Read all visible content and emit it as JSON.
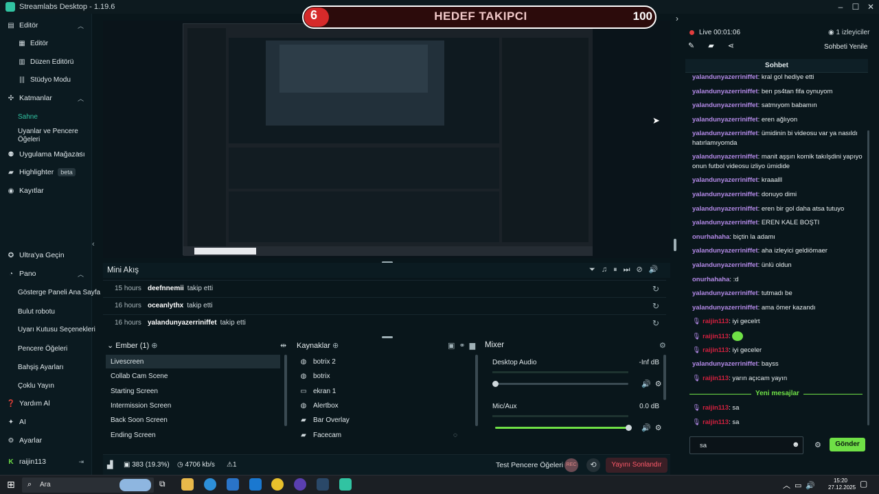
{
  "app": {
    "title": "Streamlabs Desktop - 1.19.6"
  },
  "sidebar": {
    "items": [
      {
        "label": "Editör",
        "icon": "layout-icon",
        "top": 0
      },
      {
        "label": "Editör",
        "icon": "grid-icon"
      },
      {
        "label": "Düzen Editörü",
        "icon": "columns-icon"
      },
      {
        "label": "Stüdyo Modu",
        "icon": "bars-icon"
      },
      {
        "label": "Katmanlar",
        "icon": "layers-icon"
      },
      {
        "label": "Sahne"
      },
      {
        "label": "Uyanlar ve Pencere Öğeleri"
      },
      {
        "label": "Uygulama Mağazası",
        "icon": "store-icon"
      },
      {
        "label": "Highlighter",
        "icon": "highlighter-icon",
        "badge": "beta"
      },
      {
        "label": "Kayıtlar",
        "icon": "record-icon"
      },
      {
        "label": "Ultra'ya Geçin",
        "icon": "ultra-icon"
      },
      {
        "label": "Pano",
        "icon": "dashboard-icon"
      },
      {
        "label": "Gösterge Paneli Ana Sayfa"
      },
      {
        "label": "Bulut robotu"
      },
      {
        "label": "Uyarı Kutusu Seçenekleri"
      },
      {
        "label": "Pencere Öğeleri"
      },
      {
        "label": "Bahşiş Ayarları"
      },
      {
        "label": "Çoklu Yayın"
      },
      {
        "label": "Yardım Al",
        "icon": "help-icon"
      },
      {
        "label": "AI",
        "icon": "ai-icon"
      },
      {
        "label": "Ayarlar",
        "icon": "settings-icon"
      }
    ],
    "user": "raijin113"
  },
  "goal": {
    "current": "6",
    "title": "HEDEF TAKIPCI",
    "max": "100"
  },
  "mini_feed": {
    "title": "Mini Akış",
    "events": [
      {
        "time": "15 hours",
        "name": "deefnnemii",
        "action": "takip etti"
      },
      {
        "time": "16 hours",
        "name": "oceanlythx",
        "action": "takip etti"
      },
      {
        "time": "16 hours",
        "name": "yalandunyazerriniffet",
        "action": "takip etti"
      }
    ]
  },
  "scenes": {
    "title": "Ember (1)",
    "items": [
      "Livescreen",
      "Collab Cam Scene",
      "Starting Screen",
      "Intermission Screen",
      "Back Soon Screen",
      "Ending Screen"
    ]
  },
  "sources": {
    "title": "Kaynaklar",
    "items": [
      {
        "label": "botrix 2",
        "icon": "globe-icon"
      },
      {
        "label": "botrix",
        "icon": "globe-icon"
      },
      {
        "label": "ekran 1",
        "icon": "monitor-icon"
      },
      {
        "label": "Alertbox",
        "icon": "globe-icon"
      },
      {
        "label": "Bar Overlay",
        "icon": "folder-icon"
      },
      {
        "label": "Facecam",
        "icon": "folder-icon"
      }
    ]
  },
  "mixer": {
    "title": "Mixer",
    "channels": [
      {
        "name": "Desktop Audio",
        "level": "-Inf dB",
        "volume": 0.0
      },
      {
        "name": "Mic/Aux",
        "level": "0.0 dB",
        "volume": 1.0
      }
    ]
  },
  "footer": {
    "frames": "383 (19.3%)",
    "bitrate": "4706 kb/s",
    "alerts": "1",
    "test_label": "Test Pencere Öğeleri",
    "rec_label": "REC",
    "end_label": "Yayını Sonlandır"
  },
  "live": {
    "status": "Live 00:01:06",
    "viewers": "1 izleyiciler",
    "refresh": "Sohbeti Yenile"
  },
  "chat": {
    "title": "Sohbet",
    "messages": [
      {
        "user": "yalandunyazerriniffet",
        "text": "kral gol hediye etti"
      },
      {
        "user": "yalandunyazerriniffet",
        "text": "ben ps4tan fifa oynuyom"
      },
      {
        "user": "yalandunyazerriniffet",
        "text": "satmıyom babamın"
      },
      {
        "user": "yalandunyazerriniffet",
        "text": "eren ağlıyon"
      },
      {
        "user": "yalandunyazerriniffet",
        "text": "ümidinin bi videosu var ya nasıldı hatırlamıyomda"
      },
      {
        "user": "yalandunyazerriniffet",
        "text": "manit aşşırı komik takılşdini yapıyo onun futbol videosu izliyo ümidide"
      },
      {
        "user": "yalandunyazerriniffet",
        "text": "kraaalll"
      },
      {
        "user": "yalandunyazerriniffet",
        "text": "donuyo dimi"
      },
      {
        "user": "yalandunyazerriniffet",
        "text": "eren bir gol daha atsa tutuyo"
      },
      {
        "user": "yalandunyazerriniffet",
        "text": "EREN KALE BOŞTI"
      },
      {
        "user": "onurhahaha",
        "text": "biçtin la adamı"
      },
      {
        "user": "yalandunyazerriniffet",
        "text": "aha izleyici geldiömaer"
      },
      {
        "user": "yalandunyazerriniffet",
        "text": "ünlü oldun"
      },
      {
        "user": "onurhahaha",
        "text": ":d"
      },
      {
        "user": "yalandunyazerriniffet",
        "text": "tutmadı be"
      },
      {
        "user": "yalandunyazerriniffet",
        "text": "ama ömer kazandı"
      },
      {
        "user": "raijin113",
        "text": "iyi gecelrt",
        "mod": true
      },
      {
        "user": "raijin113",
        "text": "",
        "mod": true,
        "emote": true
      },
      {
        "user": "raijin113",
        "text": "iyi geceler",
        "mod": true
      },
      {
        "user": "yalandunyazerriniffet",
        "text": "bayss"
      },
      {
        "user": "raijin113",
        "text": "yarın açıcam yayın",
        "mod": true
      }
    ],
    "new_label": "Yeni mesajlar",
    "new_messages": [
      {
        "user": "raijin113",
        "text": "sa"
      },
      {
        "user": "raijin113",
        "text": "sa"
      }
    ],
    "input_value": "sa",
    "send_label": "Gönder"
  },
  "taskbar": {
    "search": "Ara",
    "time": "15:20",
    "date": "27.12.2025"
  },
  "colors": {
    "accent": "#31c3a2",
    "green": "#6fe046",
    "goal_red": "#d52a2a",
    "user": "#b48ae8",
    "mod_user": "#d3213f"
  }
}
